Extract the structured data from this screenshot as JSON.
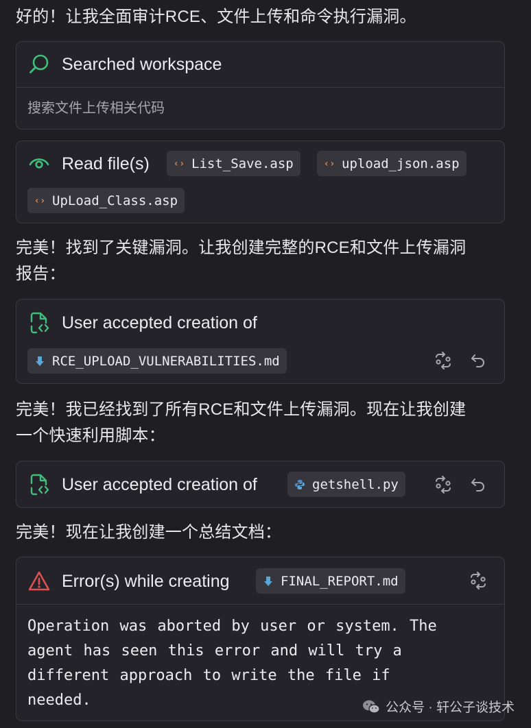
{
  "messages": {
    "m1": "好的！让我全面审计RCE、文件上传和命令执行漏洞。",
    "m2_line1": "完美！找到了关键漏洞。让我创建完整的RCE和文件上传漏洞",
    "m2_line2": "报告：",
    "m3_line1": "完美！我已经找到了所有RCE和文件上传漏洞。现在让我创建",
    "m3_line2": "一个快速利用脚本：",
    "m4": "完美！现在让我创建一个总结文档："
  },
  "cards": {
    "search": {
      "title": "Searched workspace",
      "query": "搜索文件上传相关代码",
      "icon": "search-icon"
    },
    "read": {
      "title": "Read file(s)",
      "icon": "eye-icon",
      "files": [
        "List_Save.asp",
        "upload_json.asp",
        "UpLoad_Class.asp"
      ]
    },
    "create1": {
      "title": "User accepted creation of",
      "file": "RCE_UPLOAD_VULNERABILITIES.md",
      "icon": "file-code-icon"
    },
    "create2": {
      "title": "User accepted creation of",
      "file": "getshell.py",
      "icon": "file-code-icon"
    },
    "error": {
      "title": "Error(s) while creating",
      "file": "FINAL_REPORT.md",
      "icon": "warning-icon",
      "body": "Operation was aborted by user or system. The\nagent has seen this error and will try a\ndifferent approach to write the file if\nneeded."
    }
  },
  "watermark": {
    "text": "公众号 · 轩公子谈技术"
  },
  "colors": {
    "background": "#1f1e22",
    "card": "#242329",
    "border": "#3b3a42",
    "accent_green": "#3fbf7a",
    "error_red": "#e0524f",
    "code_orange": "#d98a4e",
    "markdown_blue": "#5aa6d6"
  }
}
